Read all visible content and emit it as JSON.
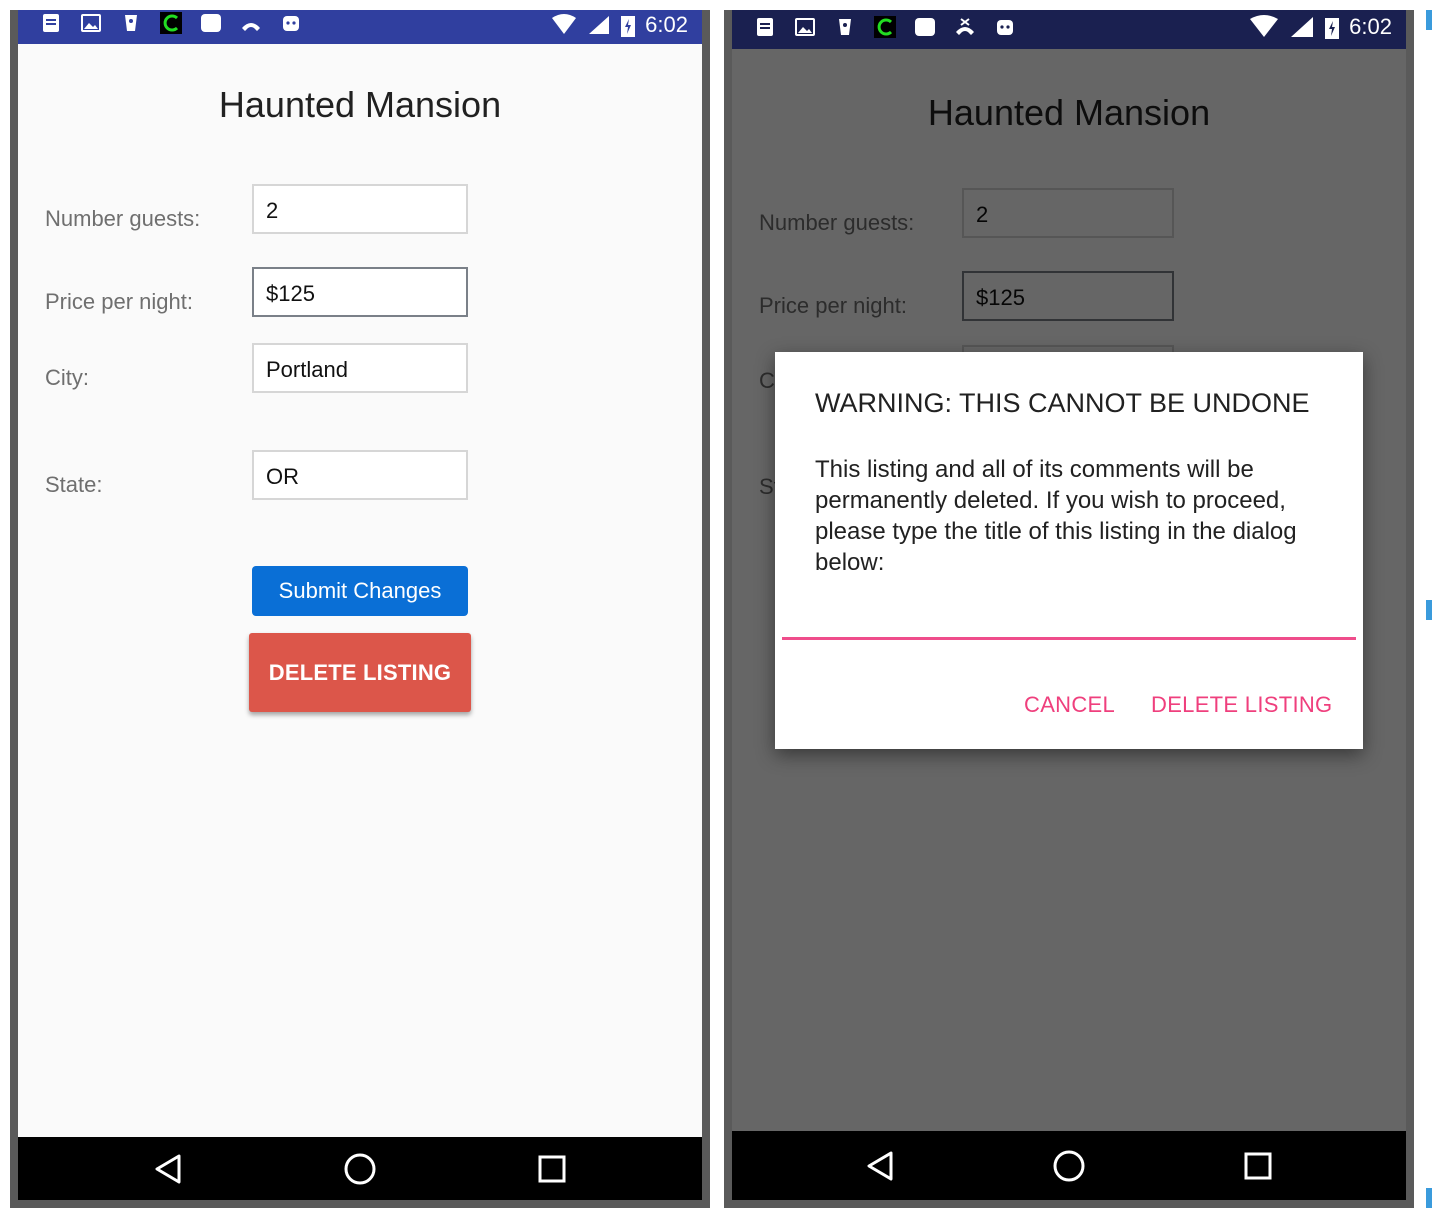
{
  "colors": {
    "statusbar": "#303f9f",
    "submit_button": "#0a6fd6",
    "delete_button": "#dc564a",
    "dialog_accent": "#ef3f7d"
  },
  "status_bar": {
    "time": "6:02",
    "icons": [
      "notes-icon",
      "image-icon",
      "shield-icon",
      "cursor-app-icon",
      "chat-icon",
      "call-icon",
      "android-icon",
      "wifi-icon",
      "signal-icon",
      "battery-charging-icon"
    ]
  },
  "form": {
    "title": "Haunted Mansion",
    "guests_label": "Number guests:",
    "guests_value": "2",
    "price_label": "Price per night:",
    "price_value": "$125",
    "city_label": "City:",
    "city_value": "Portland",
    "state_label": "State:",
    "state_value": "OR",
    "submit_label": "Submit Changes",
    "delete_label": "DELETE LISTING"
  },
  "dialog": {
    "title": "WARNING: THIS CANNOT BE UNDONE",
    "message": "This listing and all of its comments will be permanently deleted. If you wish to proceed, please type the title of this listing in the dialog below:",
    "input_value": "",
    "cancel_label": "CANCEL",
    "confirm_label": "DELETE LISTING"
  },
  "nav_bar": {
    "icons": [
      "back-icon",
      "home-icon",
      "recents-icon"
    ]
  }
}
